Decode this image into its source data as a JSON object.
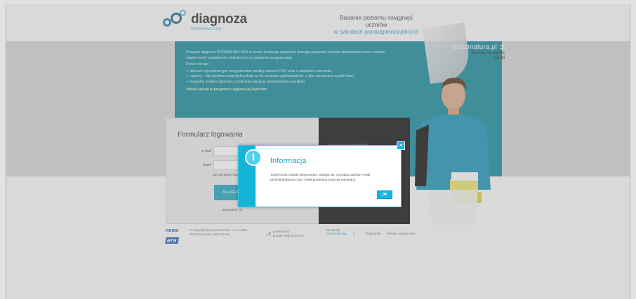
{
  "header": {
    "logo_text": "diagnoza",
    "logo_subtitle": "PRÓBNA MATURA",
    "tagline_line1": "Badanie poziomu osiągnięć uczniów",
    "tagline_line2": "w szkołach ponadgimnazjalnych"
  },
  "promo": {
    "brand": "terazmatura.pl",
    "slogan_line1": "Sposób na lepsze",
    "slogan_line2": "wyniki"
  },
  "intro": {
    "paragraph": "Program diagnoza PRÓBNA MATURA w formie próbnego egzaminu pomaga sprawdzić poziom opanowania przez uczniów wiadomości i umiejętności określonych w podstawie programowej.",
    "offers_label": "Portal oferuje:",
    "items": [
      "arkusze egzaminacyjne przygotowane według zaleceń CKE wraz z zasadami oceniania,",
      "raporty – dla dyrektora statystyki szkoły na tle wyników ogólnopolskich, a dla nauczyciela wyniki klasy,",
      "wygodny system zgłoszeń, pobierania arkuszy, wprowadzania wyników."
    ],
    "join": "Udział szkoły w programie zgłasza jej Dyrektor."
  },
  "login": {
    "title": "Formularz logowania",
    "email_label": "e-mail",
    "password_label": "hasło",
    "forgot": "Nie pamiętam hasła",
    "button": "ZALOGUJ",
    "register": "Zarejestruj się"
  },
  "dark_panel": {
    "question": "Nie masz konta w serwisie?"
  },
  "footer": {
    "logo_line1": "nowa",
    "logo_line2": "era",
    "copyright_line1": "© Copyright by Nowa Era Sp. z o.o. 2014",
    "copyright_line2": "Wszelkie prawa zastrzeżone.",
    "pd_line1": "powered by",
    "pd_line2": "portale diagnostyczne",
    "links_title": "Na skróty",
    "links": [
      "Strona główna",
      "Regulamin",
      "Polityka prywatności"
    ]
  },
  "modal": {
    "title": "Informacja",
    "message": "Twoje konto zostało aktywowane. Zaloguj się, używając adresu e-mail p1003635@bovn.com i hasła podanego podczas rejestracji.",
    "ok": "OK",
    "close": "×",
    "icon_glyph": "i"
  },
  "colors": {
    "teal": "#1e8b9b",
    "accent": "#14b7e2"
  }
}
